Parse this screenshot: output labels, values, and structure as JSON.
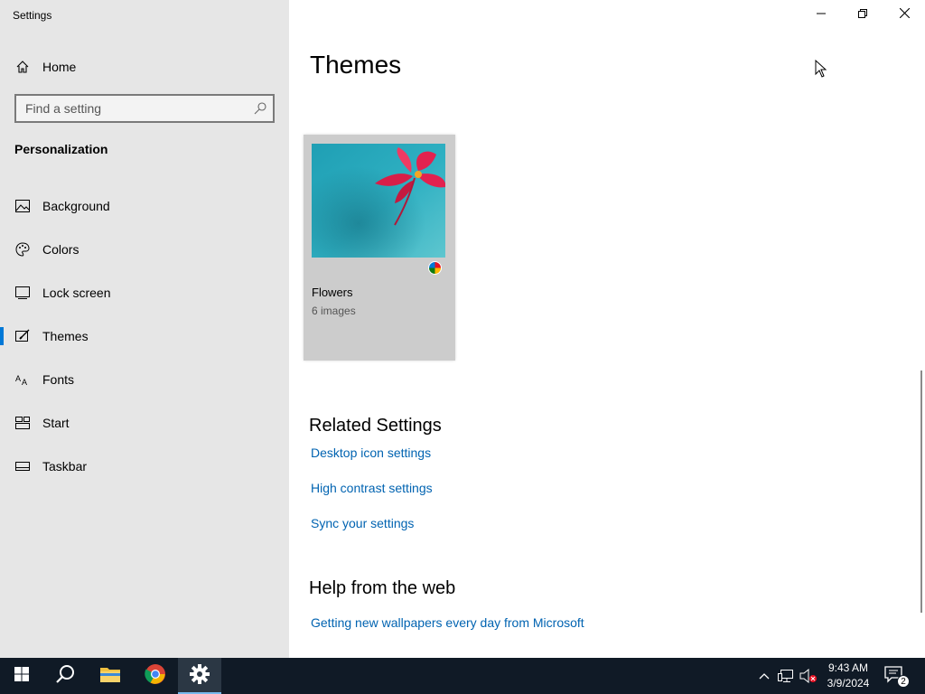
{
  "window": {
    "title": "Settings",
    "controls": {
      "minimize": "minimize-icon",
      "restore": "restore-icon",
      "close": "close-icon"
    }
  },
  "sidebar": {
    "home_label": "Home",
    "search": {
      "placeholder": "Find a setting",
      "value": ""
    },
    "section_heading": "Personalization",
    "items": [
      {
        "label": "Background",
        "icon": "picture-icon",
        "active": false
      },
      {
        "label": "Colors",
        "icon": "palette-icon",
        "active": false
      },
      {
        "label": "Lock screen",
        "icon": "lock-screen-icon",
        "active": false
      },
      {
        "label": "Themes",
        "icon": "themes-icon",
        "active": true
      },
      {
        "label": "Fonts",
        "icon": "fonts-icon",
        "active": false
      },
      {
        "label": "Start",
        "icon": "start-icon",
        "active": false
      },
      {
        "label": "Taskbar",
        "icon": "taskbar-icon",
        "active": false
      }
    ]
  },
  "main": {
    "title": "Themes",
    "themes": [
      {
        "name": "Flowers",
        "count": "6 images"
      }
    ],
    "related_settings": {
      "heading": "Related Settings",
      "links": [
        "Desktop icon settings",
        "High contrast settings",
        "Sync your settings"
      ]
    },
    "help": {
      "heading": "Help from the web",
      "links": [
        "Getting new wallpapers every day from Microsoft"
      ]
    }
  },
  "taskbar": {
    "apps": [
      "windows-start-icon",
      "search-icon",
      "file-explorer-icon",
      "chrome-icon",
      "settings-icon"
    ],
    "active_app": "settings-icon",
    "tray_icons": [
      "chevron-up-icon",
      "network-icon",
      "volume-muted-icon"
    ],
    "time": "9:43 AM",
    "date": "3/9/2024",
    "notification_count": "2"
  },
  "colors": {
    "accent": "#0078d7",
    "link": "#0063b1",
    "sidebar_bg": "#e6e6e6",
    "taskbar_bg": "#101a26"
  }
}
